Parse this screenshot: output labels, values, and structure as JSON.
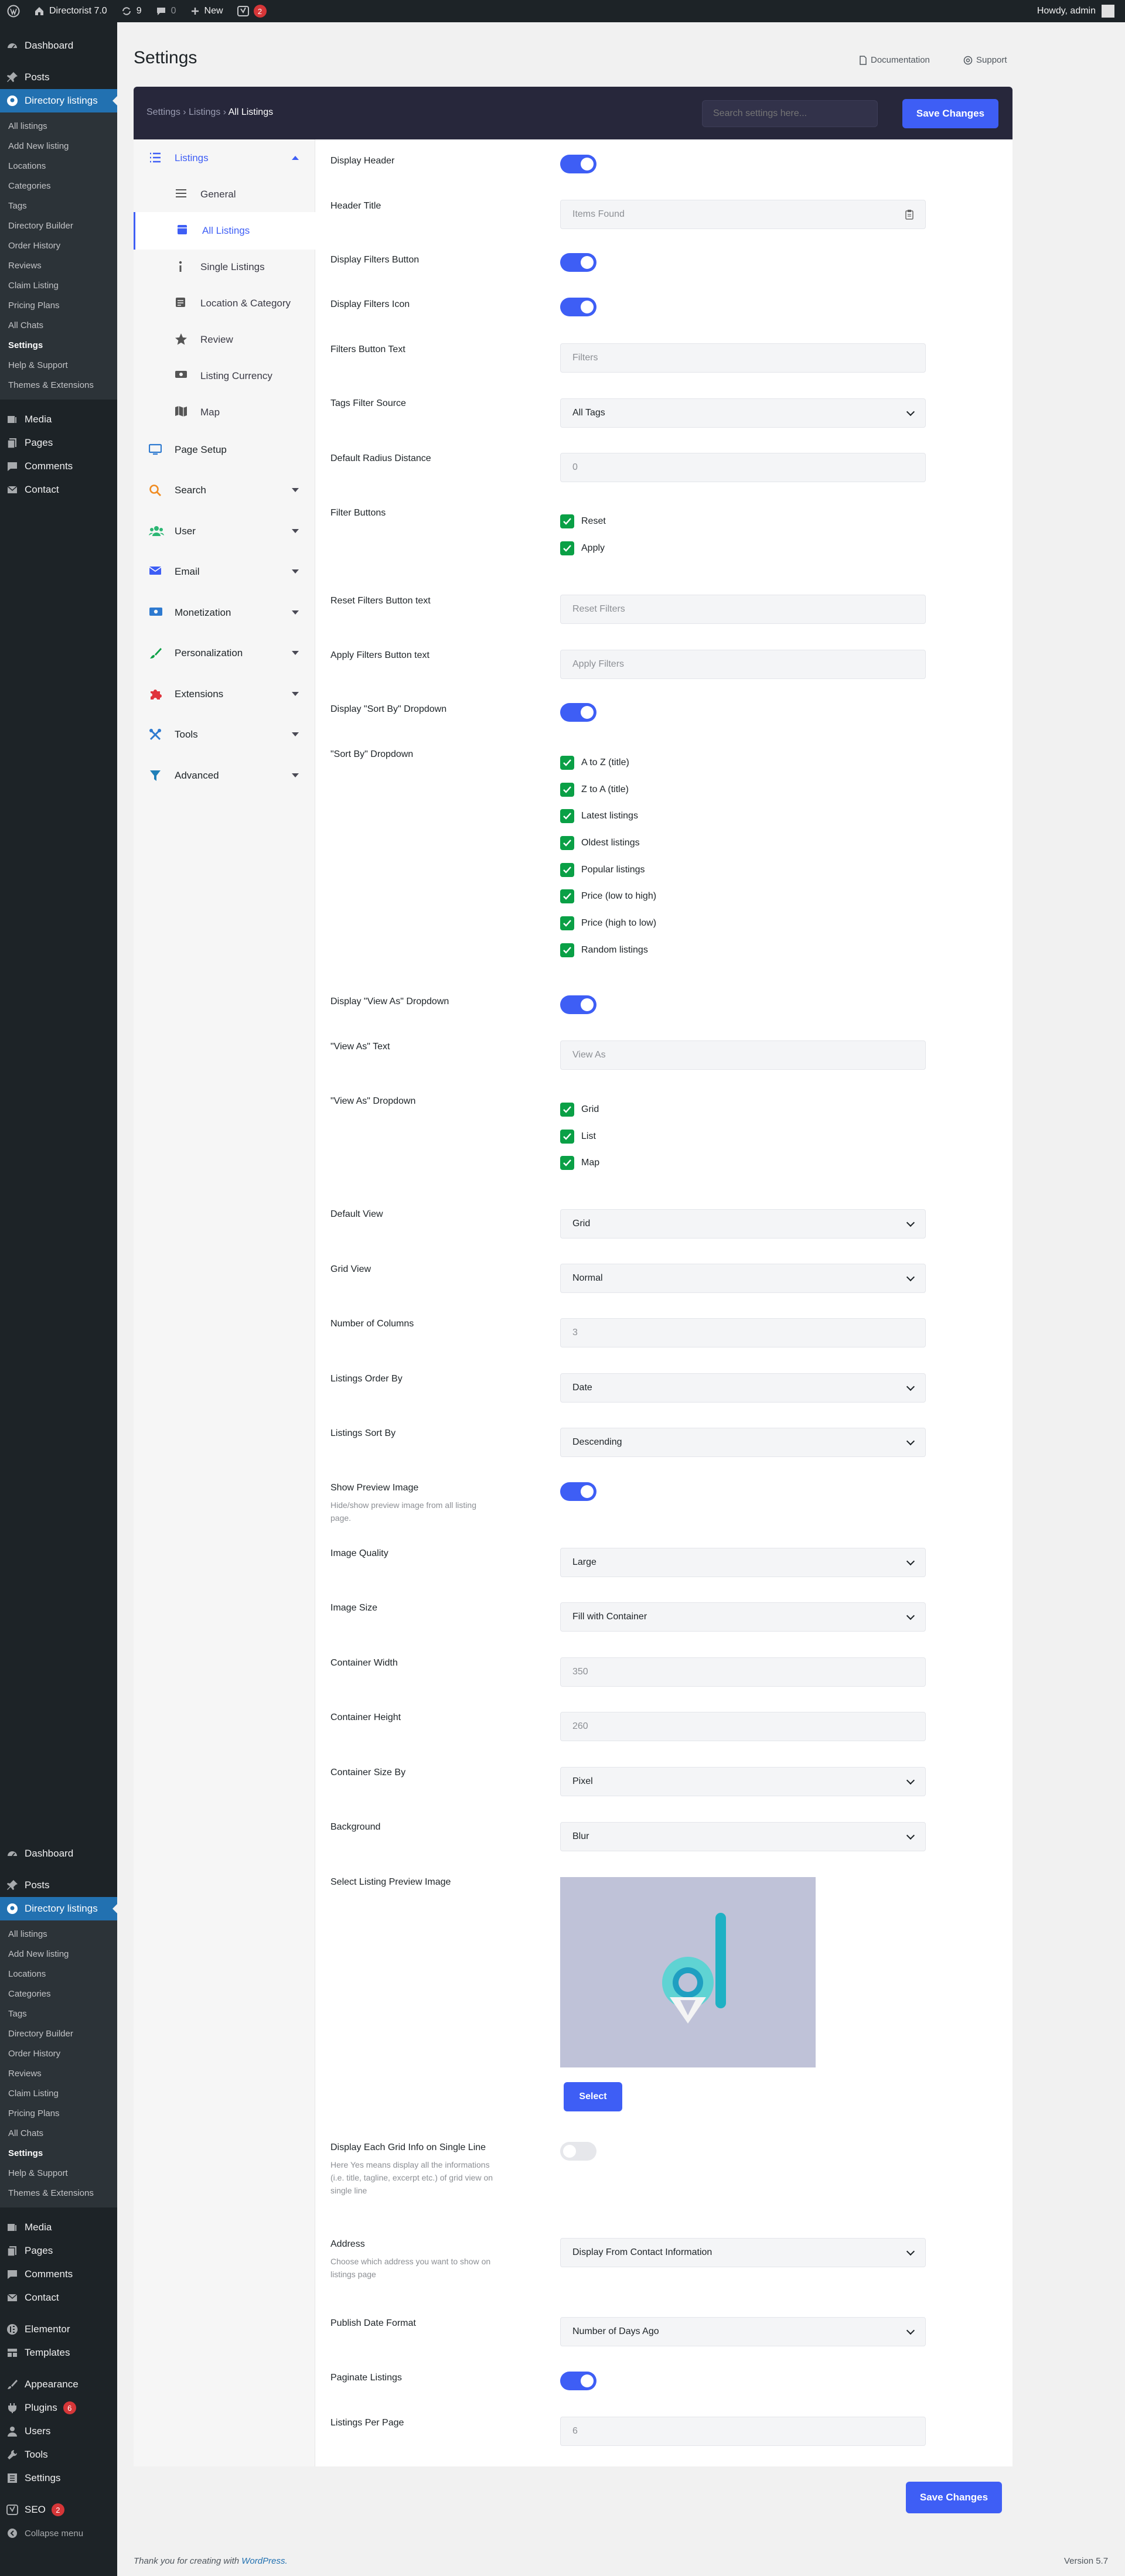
{
  "adminbar": {
    "site": "Directorist 7.0",
    "updates": "9",
    "comments": "0",
    "new": "New",
    "yoast_count": "2",
    "howdy": "Howdy, admin"
  },
  "sidebar": {
    "top": [
      "Dashboard",
      "Posts",
      "Directory listings"
    ],
    "submenu": [
      "All listings",
      "Add New listing",
      "Locations",
      "Categories",
      "Tags",
      "Directory Builder",
      "Order History",
      "Reviews",
      "Claim Listing",
      "Pricing Plans",
      "All Chats",
      "Settings",
      "Help & Support",
      "Themes & Extensions"
    ],
    "after": [
      "Media",
      "Pages",
      "Comments",
      "Contact"
    ],
    "after2": [
      "Elementor",
      "Templates"
    ],
    "after3": [
      "Appearance",
      "Plugins",
      "Users",
      "Tools",
      "Settings"
    ],
    "plugins_badge": "6",
    "seo": "SEO",
    "seo_badge": "2",
    "collapse": "Collapse menu"
  },
  "header": {
    "title": "Settings",
    "documentation": "Documentation",
    "support": "Support"
  },
  "topbar": {
    "crumb1": "Settings",
    "crumb2": "Listings",
    "crumb3": "All Listings",
    "search_placeholder": "Search settings here...",
    "save": "Save Changes"
  },
  "nav": {
    "listings": "Listings",
    "sub": [
      "General",
      "All Listings",
      "Single Listings",
      "Location & Category",
      "Review",
      "Listing Currency",
      "Map"
    ],
    "items": [
      "Page Setup",
      "Search",
      "User",
      "Email",
      "Monetization",
      "Personalization",
      "Extensions",
      "Tools",
      "Advanced"
    ]
  },
  "form": {
    "display_header": "Display Header",
    "header_title": "Header Title",
    "header_title_value": "Items Found",
    "display_filters_button": "Display Filters Button",
    "display_filters_icon": "Display Filters Icon",
    "filters_button_text": "Filters Button Text",
    "filters_button_text_value": "Filters",
    "tags_filter_source": "Tags Filter Source",
    "tags_filter_source_value": "All Tags",
    "default_radius": "Default Radius Distance",
    "default_radius_value": "0",
    "filter_buttons": "Filter Buttons",
    "filter_buttons_options": [
      "Reset",
      "Apply"
    ],
    "reset_text": "Reset Filters Button text",
    "reset_text_value": "Reset Filters",
    "apply_text": "Apply Filters Button text",
    "apply_text_value": "Apply Filters",
    "display_sortby": "Display \"Sort By\" Dropdown",
    "sortby": "\"Sort By\" Dropdown",
    "sortby_options": [
      "A to Z (title)",
      "Z to A (title)",
      "Latest listings",
      "Oldest listings",
      "Popular listings",
      "Price (low to high)",
      "Price (high to low)",
      "Random listings"
    ],
    "display_viewas": "Display \"View As\" Dropdown",
    "viewas_text": "\"View As\" Text",
    "viewas_text_value": "View As",
    "viewas": "\"View As\" Dropdown",
    "viewas_options": [
      "Grid",
      "List",
      "Map"
    ],
    "default_view": "Default View",
    "default_view_value": "Grid",
    "grid_view": "Grid View",
    "grid_view_value": "Normal",
    "columns": "Number of Columns",
    "columns_value": "3",
    "order_by": "Listings Order By",
    "order_by_value": "Date",
    "sort_by": "Listings Sort By",
    "sort_by_value": "Descending",
    "show_preview": "Show Preview Image",
    "show_preview_help": "Hide/show preview image from all listing page.",
    "image_quality": "Image Quality",
    "image_quality_value": "Large",
    "image_size": "Image Size",
    "image_size_value": "Fill with Container",
    "container_width": "Container Width",
    "container_width_value": "350",
    "container_height": "Container Height",
    "container_height_value": "260",
    "container_size_by": "Container Size By",
    "container_size_by_value": "Pixel",
    "background": "Background",
    "background_value": "Blur",
    "select_preview": "Select Listing Preview Image",
    "select_button": "Select",
    "single_line": "Display Each Grid Info on Single Line",
    "single_line_help": "Here Yes means display all the informations (i.e. title, tagline, excerpt etc.) of grid view on single line",
    "address": "Address",
    "address_help": "Choose which address you want to show on listings page",
    "address_value": "Display From Contact Information",
    "publish_date": "Publish Date Format",
    "publish_date_value": "Number of Days Ago",
    "paginate": "Paginate Listings",
    "per_page": "Listings Per Page",
    "per_page_value": "6",
    "save": "Save Changes"
  },
  "footer": {
    "thanks": "Thank you for creating with",
    "wp": "WordPress.",
    "version": "Version 5.7"
  },
  "colors": {
    "accent": "#3e5ef5",
    "check": "#0aa046",
    "wp_blue": "#2271b1",
    "dark": "#1d2327",
    "header": "#27273b"
  }
}
